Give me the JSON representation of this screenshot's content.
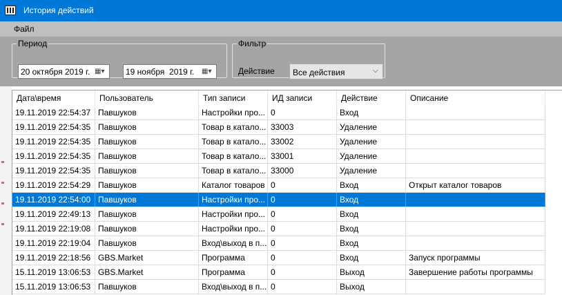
{
  "window": {
    "title": "История действий",
    "accent": "#0078d7"
  },
  "menu": {
    "file": "Файл"
  },
  "period": {
    "legend": "Период",
    "from": "20 октября 2019 г.",
    "to": "19 ноября  2019 г."
  },
  "filter": {
    "legend": "Фильтр",
    "action_label": "Действие",
    "action_value": "Все действия"
  },
  "grid": {
    "columns": [
      "Дата\\время",
      "Пользователь",
      "Тип записи",
      "ИД записи",
      "Действие",
      "Описание"
    ],
    "selected_index": 6,
    "rows": [
      [
        "19.11.2019 22:54:37",
        "Павшуков",
        "Настройки про...",
        "0",
        "Вход",
        ""
      ],
      [
        "19.11.2019 22:54:35",
        "Павшуков",
        "Товар в катало...",
        "33003",
        "Удаление",
        ""
      ],
      [
        "19.11.2019 22:54:35",
        "Павшуков",
        "Товар в катало...",
        "33002",
        "Удаление",
        ""
      ],
      [
        "19.11.2019 22:54:35",
        "Павшуков",
        "Товар в катало...",
        "33001",
        "Удаление",
        ""
      ],
      [
        "19.11.2019 22:54:35",
        "Павшуков",
        "Товар в катало...",
        "33000",
        "Удаление",
        ""
      ],
      [
        "19.11.2019 22:54:29",
        "Павшуков",
        "Каталог товаров",
        "0",
        "Вход",
        "Открыт каталог товаров"
      ],
      [
        "19.11.2019 22:54:00",
        "Павшуков",
        "Настройки про...",
        "0",
        "Вход",
        ""
      ],
      [
        "19.11.2019 22:49:13",
        "Павшуков",
        "Настройки про...",
        "0",
        "Вход",
        ""
      ],
      [
        "19.11.2019 22:19:08",
        "Павшуков",
        "Настройки про...",
        "0",
        "Вход",
        ""
      ],
      [
        "19.11.2019 22:19:04",
        "Павшуков",
        "Вход\\выход в п...",
        "0",
        "Вход",
        ""
      ],
      [
        "19.11.2019 22:18:56",
        "GBS.Market",
        "Программа",
        "0",
        "Вход",
        "Запуск программы"
      ],
      [
        "15.11.2019 13:06:53",
        "GBS.Market",
        "Программа",
        "0",
        "Выход",
        "Завершение работы программы"
      ],
      [
        "15.11.2019 13:06:53",
        "Павшуков",
        "Вход\\выход в п...",
        "0",
        "Выход",
        ""
      ]
    ]
  }
}
